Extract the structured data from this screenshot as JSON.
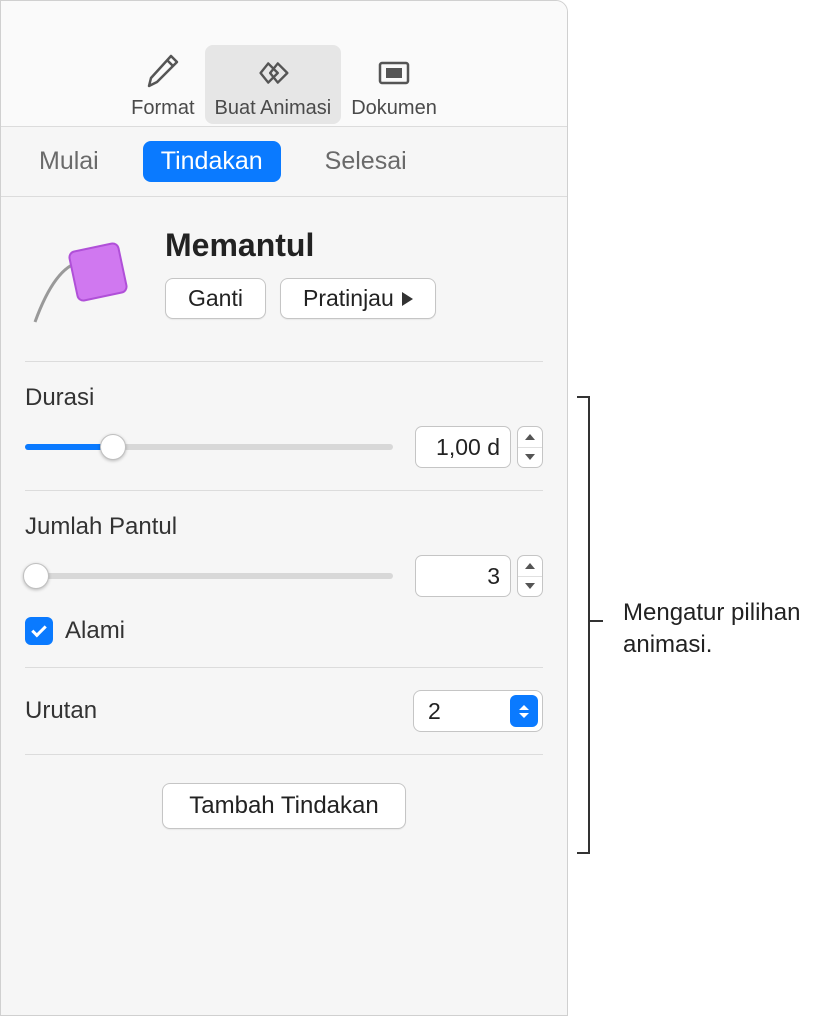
{
  "toolbar": {
    "format_label": "Format",
    "animate_label": "Buat Animasi",
    "document_label": "Dokumen"
  },
  "tabs": {
    "start_label": "Mulai",
    "action_label": "Tindakan",
    "end_label": "Selesai"
  },
  "effect": {
    "title": "Memantul",
    "change_label": "Ganti",
    "preview_label": "Pratinjau"
  },
  "duration": {
    "label": "Durasi",
    "value": "1,00 d",
    "slider_percent": 24
  },
  "bounces": {
    "label": "Jumlah Pantul",
    "value": "3",
    "slider_percent": 3,
    "natural_label": "Alami",
    "natural_checked": true
  },
  "order": {
    "label": "Urutan",
    "value": "2"
  },
  "add_action_label": "Tambah Tindakan",
  "callout": {
    "text": "Mengatur pilihan animasi."
  }
}
